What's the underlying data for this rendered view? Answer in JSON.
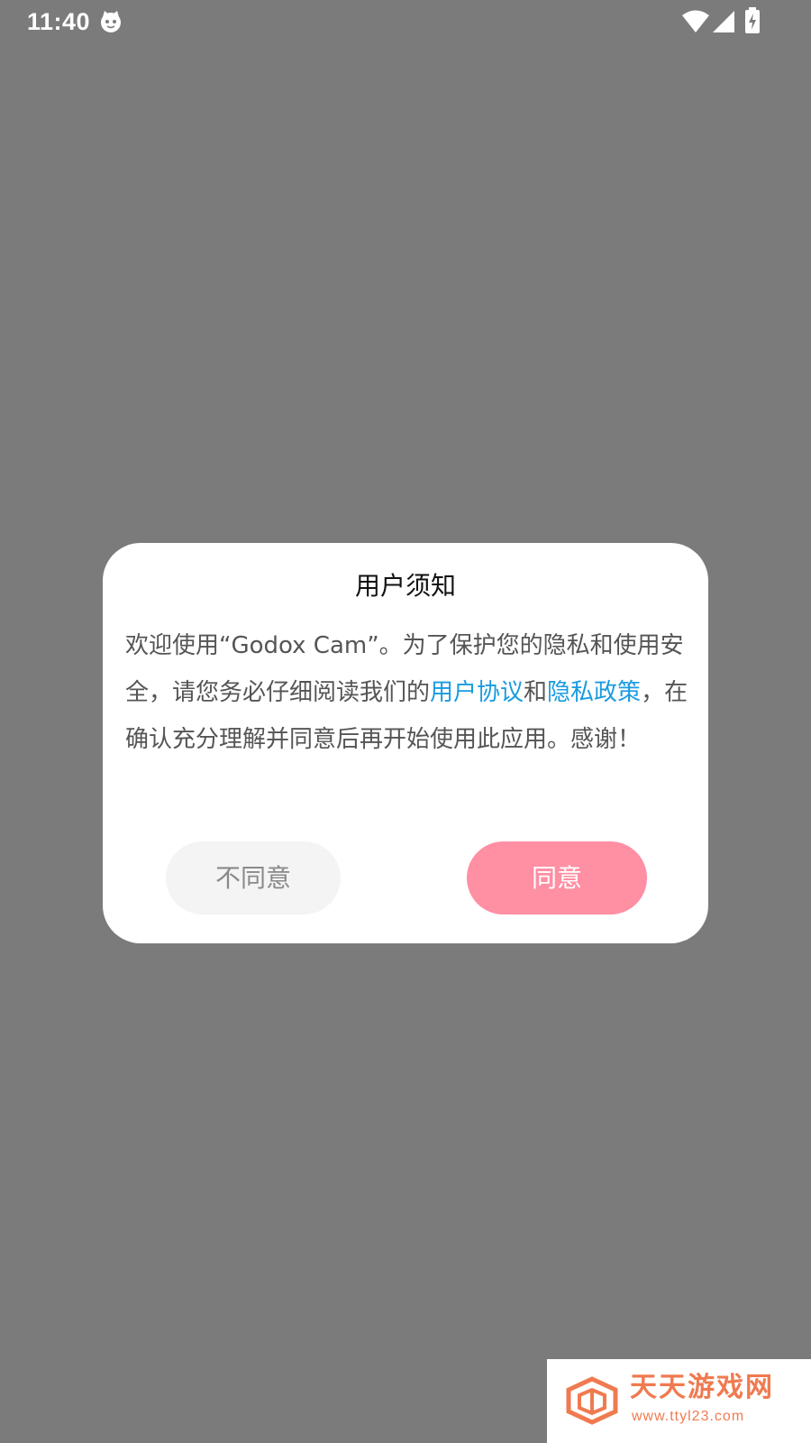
{
  "status_bar": {
    "time": "11:40",
    "app_icon": "cat-face-icon",
    "wifi_icon": "wifi-icon",
    "signal_icon": "cell-signal-icon",
    "battery_icon": "battery-charging-icon"
  },
  "dialog": {
    "title": "用户须知",
    "body_prefix": "欢迎使用“Godox Cam”。为了保护您的隐私和使用安全，请您务必仔细阅读我们的",
    "user_agreement_link": "用户协议",
    "conjunction": "和",
    "privacy_policy_link": "隐私政策",
    "body_suffix": "，在确认充分理解并同意后再开始使用此应用。感谢！",
    "disagree_label": "不同意",
    "agree_label": "同意"
  },
  "watermark": {
    "name": "天天游戏网",
    "url": "www.ttyl23.com"
  },
  "colors": {
    "overlay": "#7b7b7b",
    "link": "#1a9be0",
    "agree_button": "#ff8fa3",
    "disagree_button": "#f4f4f4",
    "watermark": "#f07a50"
  }
}
